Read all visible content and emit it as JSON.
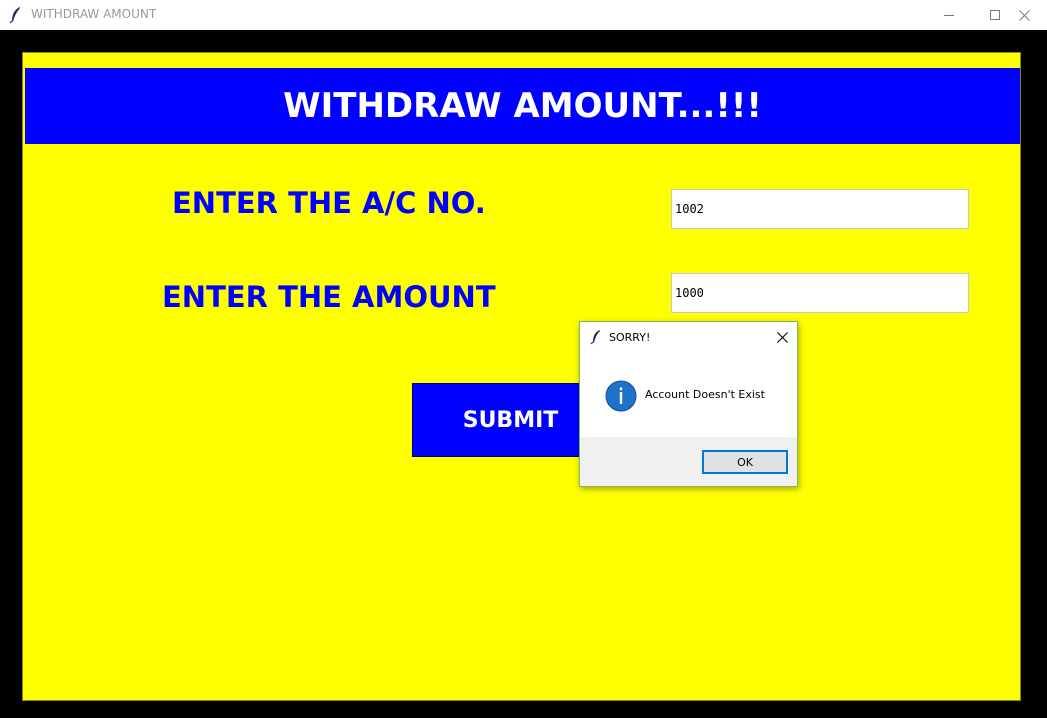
{
  "window": {
    "title": "WITHDRAW AMOUNT",
    "icon": "feather-icon",
    "controls": {
      "minimize_icon": "minimize-icon",
      "maximize_icon": "maximize-icon",
      "close_icon": "close-icon"
    }
  },
  "form": {
    "heading": "WITHDRAW AMOUNT...!!!",
    "account_label": "ENTER THE A/C NO.",
    "account_value": "1002",
    "amount_label": "ENTER THE AMOUNT",
    "amount_value": "1000",
    "submit_label": "SUBMIT"
  },
  "dialog": {
    "title": "SORRY!",
    "icon": "info-icon",
    "message": "Account Doesn't Exist",
    "ok_label": "OK"
  },
  "colors": {
    "background": "#ffff00",
    "accent_blue": "#0000ff",
    "frame": "#000000",
    "focus_border": "#0078d7"
  }
}
